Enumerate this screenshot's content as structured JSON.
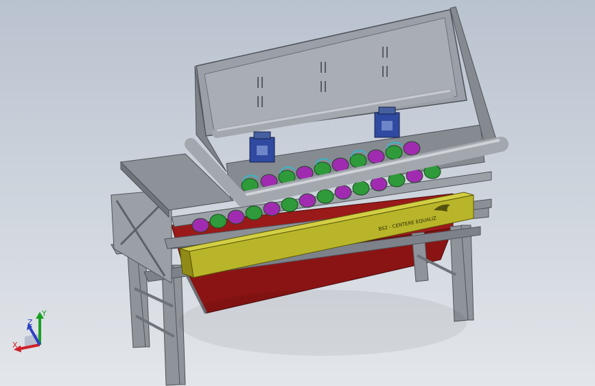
{
  "viewport": {
    "background_top": "#b9c2cf",
    "background_bottom": "#e3e6ea"
  },
  "model": {
    "beam_label": "BS2 - CENTERE EQUALIZ",
    "colors": {
      "frame": "#8f949b",
      "frame_dark": "#6e737a",
      "hood": "#9b9fa8",
      "tube": "#a3a7ae",
      "yellow_beam": "#b9b52a",
      "yellow_beam_dark": "#8f8b16",
      "red_panel": "#8a1414",
      "rollers_green": "#2f9a3a",
      "rollers_magenta": "#a12bb0",
      "rollers_cyan": "#37b6c4",
      "motor_blue": "#2f4aa0"
    }
  },
  "triad": {
    "x_label": "X",
    "y_label": "Y",
    "z_label": "Z",
    "x_color": "#d0202a",
    "y_color": "#18a025",
    "z_color": "#2b3fc4"
  }
}
